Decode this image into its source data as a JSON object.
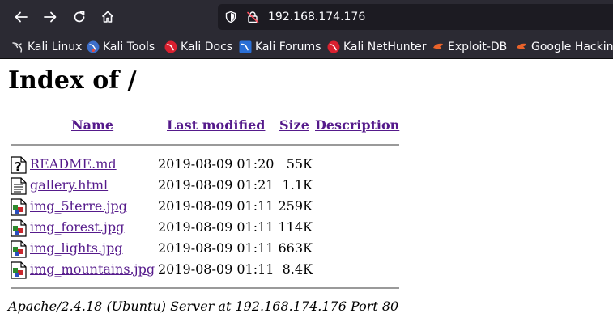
{
  "browser": {
    "url": "192.168.174.176",
    "bookmarks": [
      {
        "label": "Kali Linux",
        "icon": "kali-dragon-icon"
      },
      {
        "label": "Kali Tools",
        "icon": "kali-tools-icon"
      },
      {
        "label": "Kali Docs",
        "icon": "kali-docs-icon"
      },
      {
        "label": "Kali Forums",
        "icon": "kali-forums-icon"
      },
      {
        "label": "Kali NetHunter",
        "icon": "kali-nethunter-icon"
      },
      {
        "label": "Exploit-DB",
        "icon": "exploit-db-icon"
      },
      {
        "label": "Google Hacking",
        "icon": "google-hacking-icon"
      }
    ]
  },
  "page": {
    "title": "Index of /",
    "columns": {
      "name": "Name",
      "last_modified": "Last modified",
      "size": "Size",
      "description": "Description"
    },
    "files": [
      {
        "name": "README.md",
        "modified": "2019-08-09 01:20",
        "size": "55K",
        "icon": "unknown-file-icon"
      },
      {
        "name": "gallery.html",
        "modified": "2019-08-09 01:21",
        "size": "1.1K",
        "icon": "text-file-icon"
      },
      {
        "name": "img_5terre.jpg",
        "modified": "2019-08-09 01:11",
        "size": "259K",
        "icon": "image-file-icon"
      },
      {
        "name": "img_forest.jpg",
        "modified": "2019-08-09 01:11",
        "size": "114K",
        "icon": "image-file-icon"
      },
      {
        "name": "img_lights.jpg",
        "modified": "2019-08-09 01:11",
        "size": "663K",
        "icon": "image-file-icon"
      },
      {
        "name": "img_mountains.jpg",
        "modified": "2019-08-09 01:11",
        "size": "8.4K",
        "icon": "image-file-icon"
      }
    ],
    "footer": "Apache/2.4.18 (Ubuntu) Server at 192.168.174.176 Port 80"
  },
  "colors": {
    "chrome_bg": "#2b2a33",
    "urlbar_bg": "#1c1b22",
    "link": "#551a8b"
  }
}
